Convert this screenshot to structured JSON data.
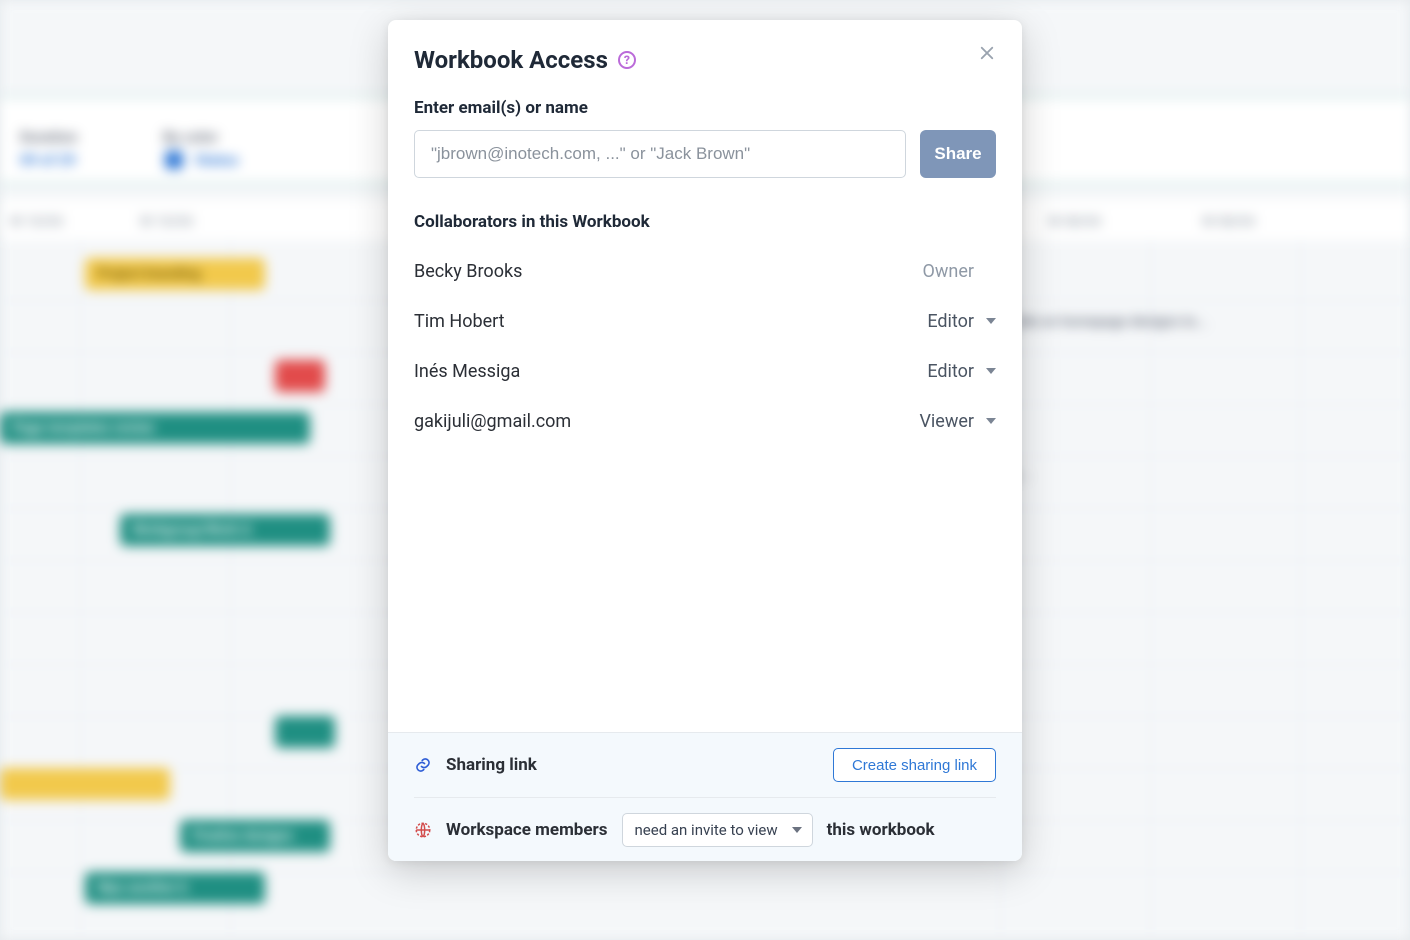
{
  "modal": {
    "title": "Workbook Access",
    "email_label": "Enter email(s) or name",
    "email_placeholder": "\"jbrown@inotech.com, ...\" or \"Jack Brown\"",
    "share_button": "Share",
    "collaborators_label": "Collaborators in this Workbook",
    "collaborators": [
      {
        "name": "Becky Brooks",
        "role": "Owner",
        "editable": false
      },
      {
        "name": "Tim Hobert",
        "role": "Editor",
        "editable": true
      },
      {
        "name": "Inés Messiga",
        "role": "Editor",
        "editable": true
      },
      {
        "name": "gakijuli@gmail.com",
        "role": "Viewer",
        "editable": true
      }
    ],
    "footer": {
      "sharing_link_label": "Sharing link",
      "create_link_button": "Create sharing link",
      "workspace_label": "Workspace members",
      "workspace_select_value": "need an invite to view",
      "workspace_trail": "this workbook"
    }
  },
  "icons": {
    "help": "?",
    "close": "×"
  }
}
